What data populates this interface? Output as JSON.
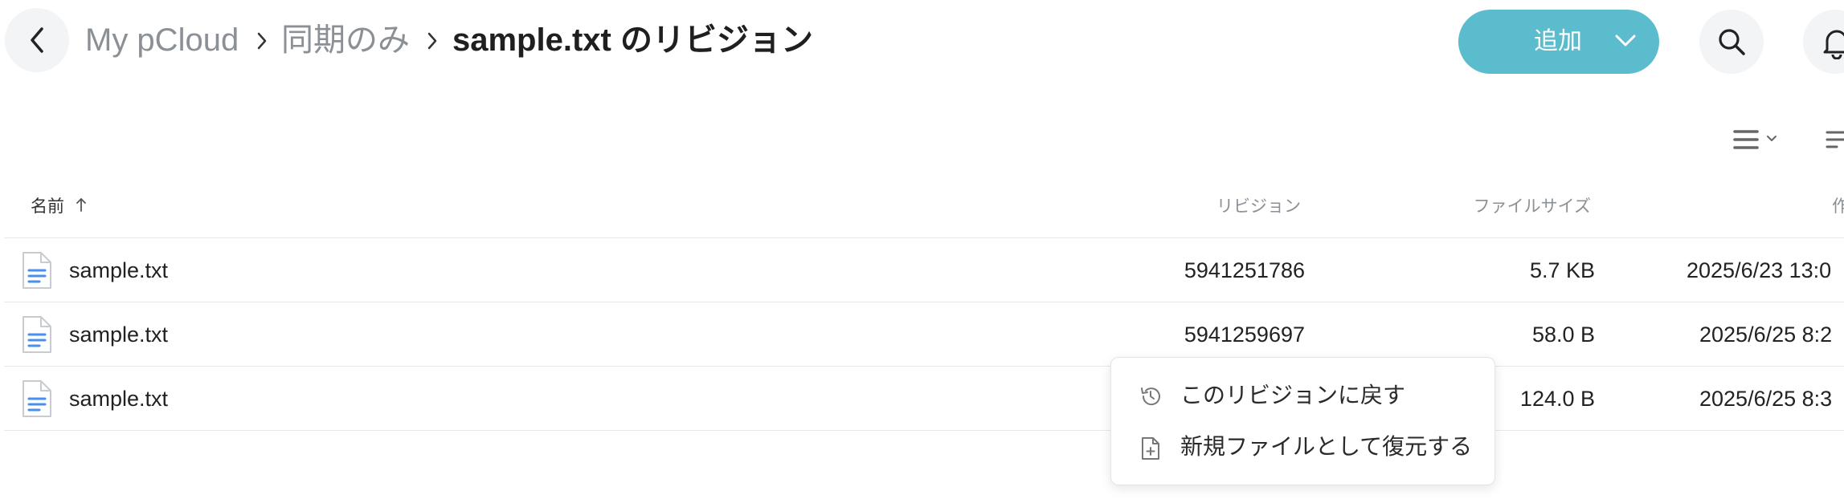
{
  "breadcrumb": {
    "items": [
      "My pCloud",
      "同期のみ"
    ],
    "current": "sample.txt のリビジョン"
  },
  "header": {
    "add_label": "追加"
  },
  "icons": {
    "back": "chevron-left-icon",
    "search": "search-icon",
    "notifications": "bell-icon",
    "list_view": "list-view-icon",
    "sort": "sort-icon"
  },
  "colors": {
    "accent": "#5bbccd",
    "file_icon": "#4a8fe7"
  },
  "table": {
    "columns": {
      "name": "名前",
      "revision": "リビジョン",
      "size": "ファイルサイズ",
      "date": "作"
    },
    "rows": [
      {
        "name": "sample.txt",
        "revision": "5941251786",
        "size": "5.7 KB",
        "date": "2025/6/23 13:0"
      },
      {
        "name": "sample.txt",
        "revision": "5941259697",
        "size": "58.0 B",
        "date": "2025/6/25 8:2"
      },
      {
        "name": "sample.txt",
        "revision": "",
        "size": "124.0 B",
        "date": "2025/6/25 8:3"
      }
    ]
  },
  "context_menu": {
    "items": [
      {
        "label": "このリビジョンに戻す",
        "icon": "history-icon"
      },
      {
        "label": "新規ファイルとして復元する",
        "icon": "file-add-icon"
      }
    ]
  }
}
